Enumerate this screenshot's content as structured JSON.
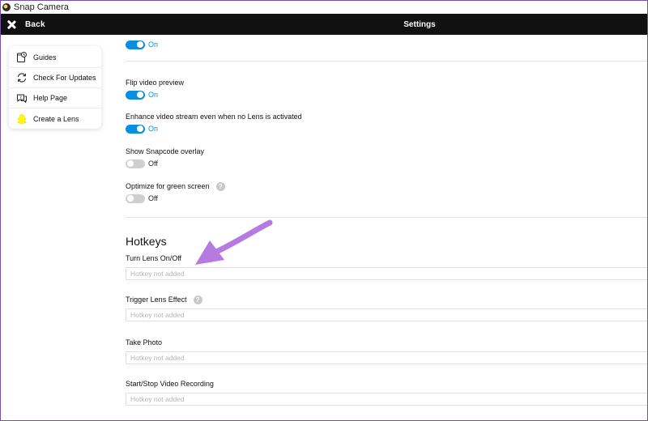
{
  "window": {
    "title": "Snap Camera"
  },
  "header": {
    "back_label": "Back",
    "title": "Settings"
  },
  "sidebar": {
    "items": [
      {
        "label": "Guides",
        "icon": "guides-icon"
      },
      {
        "label": "Check For Updates",
        "icon": "refresh-icon"
      },
      {
        "label": "Help Page",
        "icon": "help-page-icon"
      },
      {
        "label": "Create a Lens",
        "icon": "create-lens-icon"
      }
    ]
  },
  "settings": {
    "top_partial": {
      "state": "On"
    },
    "flip_video": {
      "label": "Flip video preview",
      "state": "On"
    },
    "enhance_stream": {
      "label": "Enhance video stream even when no Lens is activated",
      "state": "On"
    },
    "snapcode_overlay": {
      "label": "Show Snapcode overlay",
      "state": "Off"
    },
    "green_screen": {
      "label": "Optimize for green screen",
      "state": "Off",
      "help": "?"
    }
  },
  "hotkeys": {
    "title": "Hotkeys",
    "items": [
      {
        "label": "Turn Lens On/Off",
        "placeholder": "Hotkey not added"
      },
      {
        "label": "Trigger Lens Effect",
        "placeholder": "Hotkey not added",
        "help": "?"
      },
      {
        "label": "Take Photo",
        "placeholder": "Hotkey not added"
      },
      {
        "label": "Start/Stop Video Recording",
        "placeholder": "Hotkey not added"
      }
    ]
  },
  "colors": {
    "accent": "#0a8fe0",
    "header_bg": "#111111",
    "annotation_arrow": "#b57be0"
  }
}
